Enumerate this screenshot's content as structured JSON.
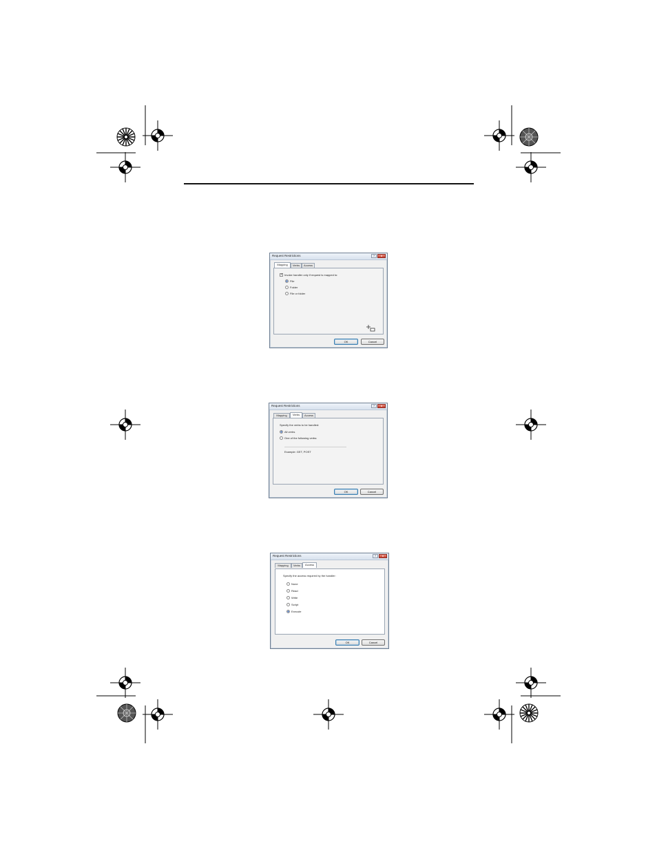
{
  "dialogs": [
    {
      "title": "Request Restrictions",
      "help_label": "?",
      "close_label": "x",
      "tabs": [
        "Mapping",
        "Verbs",
        "Access"
      ],
      "active_tab": "Mapping",
      "checkbox_label": "Invoke handler only if request is mapped to:",
      "checkbox_checked": true,
      "options": [
        {
          "label": "File",
          "selected": true
        },
        {
          "label": "Folder",
          "selected": false
        },
        {
          "label": "File or folder",
          "selected": false
        }
      ],
      "ok_label": "OK",
      "cancel_label": "Cancel"
    },
    {
      "title": "Request Restrictions",
      "help_label": "?",
      "close_label": "x",
      "tabs": [
        "Mapping",
        "Verbs",
        "Access"
      ],
      "active_tab": "Verbs",
      "prompt": "Specify the verbs to be handled:",
      "options": [
        {
          "label": "All verbs",
          "selected": true
        },
        {
          "label": "One of the following verbs:",
          "selected": false
        }
      ],
      "verbs_input_value": "",
      "example": "Example: GET, POST",
      "ok_label": "OK",
      "cancel_label": "Cancel"
    },
    {
      "title": "Request Restrictions",
      "help_label": "?",
      "close_label": "x",
      "tabs": [
        "Mapping",
        "Verbs",
        "Access"
      ],
      "active_tab": "Access",
      "prompt": "Specify the access required by the handler:",
      "options": [
        {
          "label": "None",
          "selected": false
        },
        {
          "label": "Read",
          "selected": false
        },
        {
          "label": "Write",
          "selected": false
        },
        {
          "label": "Script",
          "selected": false
        },
        {
          "label": "Execute",
          "selected": true
        }
      ],
      "ok_label": "OK",
      "cancel_label": "Cancel"
    }
  ]
}
